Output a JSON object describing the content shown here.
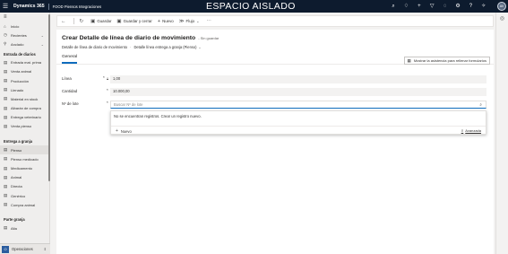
{
  "topbar": {
    "brand": "Dynamics 365",
    "app": "FOOD Piensos Integraciones",
    "center_title": "ESPACIO AISLADO",
    "avatar_initials": "AV",
    "icons": [
      "search-icon",
      "lightbulb-icon",
      "plus-icon",
      "filter-icon",
      "bell-icon",
      "gear-icon",
      "help-icon",
      "copilot-icon"
    ]
  },
  "sidebar": {
    "top": [
      {
        "label": "Inicio",
        "icon": "home-icon"
      },
      {
        "label": "Recientes",
        "icon": "clock-icon",
        "chevron": true
      },
      {
        "label": "Anclado",
        "icon": "pin-icon",
        "chevron": true
      }
    ],
    "groups": [
      {
        "title": "Entrada de diarios",
        "items": [
          "Entrada mat. prima",
          "Venta animal",
          "Producción",
          "Llenado",
          "Material en stock",
          "Albarán de compra",
          "Entrega veterinario",
          "Venta pienso"
        ]
      },
      {
        "title": "Entrega a granja",
        "items": [
          "Pienso",
          "Pienso medicado",
          "Medicamento",
          "Animal",
          "Directa",
          "Genérico",
          "Compra animal"
        ]
      },
      {
        "title": "Parte granja",
        "items": [
          "Alta"
        ]
      }
    ],
    "area": {
      "badge": "O",
      "label": "Operaciones"
    }
  },
  "commandbar": {
    "back": "←",
    "refresh": "↻",
    "save": "Guardar",
    "save_close": "Guardar y cerrar",
    "new": "Nuevo",
    "flow": "Flujo",
    "more": "⋯"
  },
  "form": {
    "title": "Crear Detalle de línea de diario de movimiento",
    "unsaved": "- Sin guardar",
    "subtitle_entity": "Detalle de línea de diario de movimiento",
    "subtitle_form": "Detalle línea entrega a granja (Pienso)",
    "tab": "General",
    "assist_button": "Mostrar la asistencia para rellenar formularios",
    "fields": {
      "linea_label": "Línea",
      "linea_value": "1,00",
      "cantidad_label": "Cantidad",
      "cantidad_value": "10.000,00",
      "lote_label": "Nº de lote",
      "lote_placeholder": "Buscar Nº de lote"
    },
    "lookup": {
      "no_results": "No se encuentran registros. Crear un registro nuevo.",
      "new_label": "Nuevo",
      "advanced_label": "Avanzada"
    }
  },
  "colors": {
    "topbar": "#0d1b2e",
    "accent": "#0f6cbd"
  }
}
